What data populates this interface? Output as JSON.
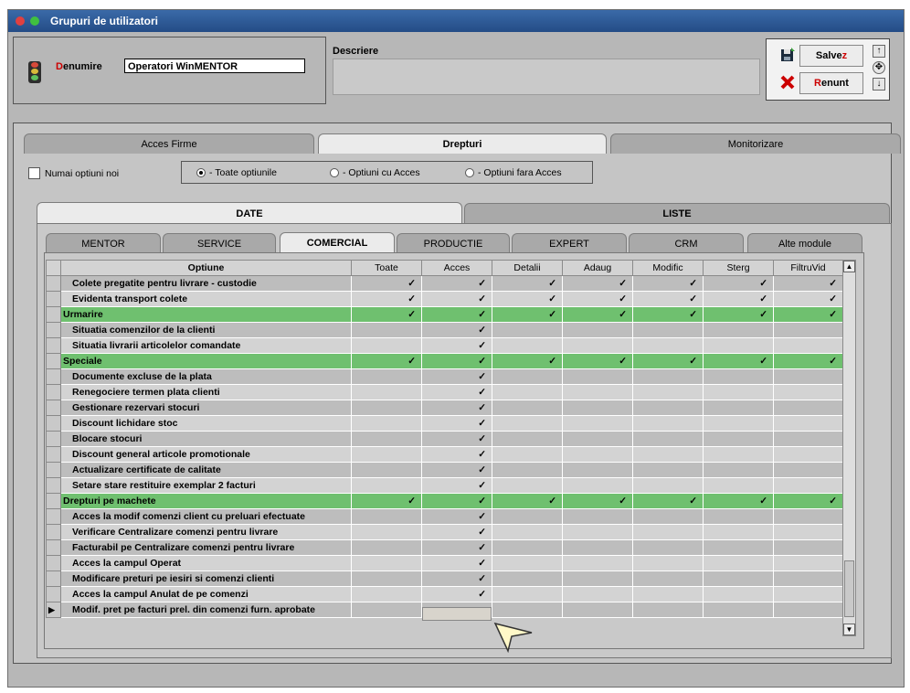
{
  "window": {
    "title": "Grupuri de utilizatori"
  },
  "header": {
    "denumire_label_first": "D",
    "denumire_label_rest": "enumire",
    "denumire_value": "Operatori WinMENTOR",
    "descriere_label": "Descriere",
    "descriere_value": ""
  },
  "buttons": {
    "save_label_main": "Salve",
    "save_label_accent": "z",
    "cancel_label_accent": "R",
    "cancel_label_main": "enunt"
  },
  "top_tabs": [
    "Acces Firme",
    "Drepturi",
    "Monitorizare"
  ],
  "filters": {
    "checkbox_label": "Numai optiuni noi",
    "radios": [
      "- Toate optiunile",
      "- Optiuni cu  Acces",
      "- Optiuni fara Acces"
    ],
    "selected_radio": 0
  },
  "section_tabs": [
    "DATE",
    "LISTE"
  ],
  "module_tabs": [
    "MENTOR",
    "SERVICE",
    "COMERCIAL",
    "PRODUCTIE",
    "EXPERT",
    "CRM",
    "Alte module"
  ],
  "active_module_tab": 2,
  "grid": {
    "columns": [
      "Optiune",
      "Toate",
      "Acces",
      "Detalii",
      "Adaug",
      "Modific",
      "Sterg",
      "FiltruVid"
    ],
    "check_glyph": "✓",
    "rows": [
      {
        "label": "Colete pregatite pentru livrare - custodie",
        "type": "item",
        "checks": [
          1,
          1,
          1,
          1,
          1,
          1,
          1
        ]
      },
      {
        "label": "Evidenta transport colete",
        "type": "item",
        "checks": [
          1,
          1,
          1,
          1,
          1,
          1,
          1
        ]
      },
      {
        "label": "Urmarire",
        "type": "group",
        "checks": [
          1,
          1,
          1,
          1,
          1,
          1,
          1
        ]
      },
      {
        "label": "Situatia comenzilor de la clienti",
        "type": "item",
        "checks": [
          0,
          1,
          0,
          0,
          0,
          0,
          0
        ]
      },
      {
        "label": "Situatia livrarii articolelor comandate",
        "type": "item",
        "checks": [
          0,
          1,
          0,
          0,
          0,
          0,
          0
        ]
      },
      {
        "label": "Speciale",
        "type": "group",
        "checks": [
          1,
          1,
          1,
          1,
          1,
          1,
          1
        ]
      },
      {
        "label": "Documente excluse de la plata",
        "type": "item",
        "checks": [
          0,
          1,
          0,
          0,
          0,
          0,
          0
        ]
      },
      {
        "label": "Renegociere termen plata clienti",
        "type": "item",
        "checks": [
          0,
          1,
          0,
          0,
          0,
          0,
          0
        ]
      },
      {
        "label": "Gestionare rezervari stocuri",
        "type": "item",
        "checks": [
          0,
          1,
          0,
          0,
          0,
          0,
          0
        ]
      },
      {
        "label": "Discount lichidare stoc",
        "type": "item",
        "checks": [
          0,
          1,
          0,
          0,
          0,
          0,
          0
        ]
      },
      {
        "label": "Blocare stocuri",
        "type": "item",
        "checks": [
          0,
          1,
          0,
          0,
          0,
          0,
          0
        ]
      },
      {
        "label": "Discount general articole promotionale",
        "type": "item",
        "checks": [
          0,
          1,
          0,
          0,
          0,
          0,
          0
        ]
      },
      {
        "label": "Actualizare certificate de calitate",
        "type": "item",
        "checks": [
          0,
          1,
          0,
          0,
          0,
          0,
          0
        ]
      },
      {
        "label": "Setare stare restituire exemplar 2 facturi",
        "type": "item",
        "checks": [
          0,
          1,
          0,
          0,
          0,
          0,
          0
        ]
      },
      {
        "label": "Drepturi pe machete",
        "type": "group",
        "checks": [
          1,
          1,
          1,
          1,
          1,
          1,
          1
        ]
      },
      {
        "label": "Acces la modif comenzi client cu preluari efectuate",
        "type": "item",
        "checks": [
          0,
          1,
          0,
          0,
          0,
          0,
          0
        ]
      },
      {
        "label": "Verificare Centralizare comenzi pentru livrare",
        "type": "item",
        "checks": [
          0,
          1,
          0,
          0,
          0,
          0,
          0
        ]
      },
      {
        "label": "Facturabil pe Centralizare comenzi pentru livrare",
        "type": "item",
        "checks": [
          0,
          1,
          0,
          0,
          0,
          0,
          0
        ]
      },
      {
        "label": "Acces la campul Operat",
        "type": "item",
        "checks": [
          0,
          1,
          0,
          0,
          0,
          0,
          0
        ]
      },
      {
        "label": "Modificare preturi pe iesiri si comenzi clienti",
        "type": "item",
        "checks": [
          0,
          1,
          0,
          0,
          0,
          0,
          0
        ]
      },
      {
        "label": "Acces la campul Anulat de pe comenzi",
        "type": "item",
        "checks": [
          0,
          1,
          0,
          0,
          0,
          0,
          0
        ]
      },
      {
        "label": "Modif. pret pe facturi prel. din comenzi furn. aprobate",
        "type": "item",
        "checks": [
          0,
          0,
          0,
          0,
          0,
          0,
          0
        ],
        "current": true
      }
    ]
  },
  "colors": {
    "group_row": "#6fc06f",
    "title_bar": "#2f5c98",
    "accent_red": "#cc0000"
  }
}
